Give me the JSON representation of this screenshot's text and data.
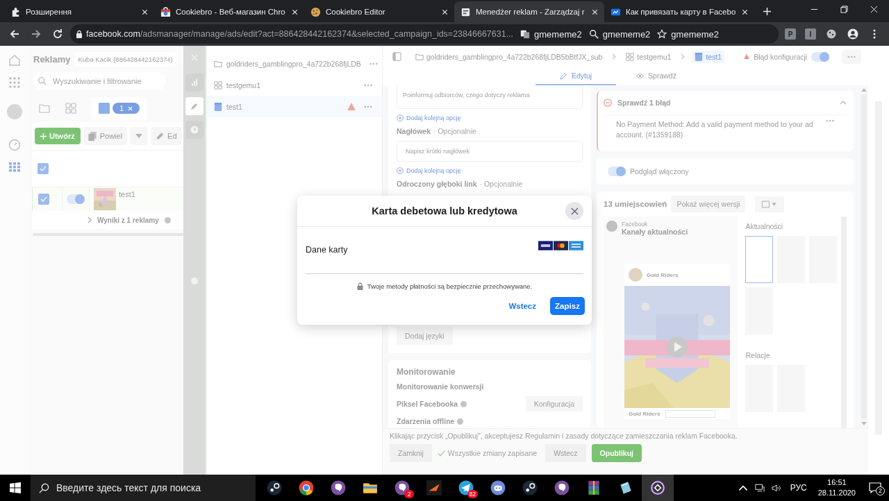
{
  "browser": {
    "tabs": [
      {
        "kind": "puzzle",
        "title": "Розширення",
        "selected": false
      },
      {
        "kind": "store",
        "title": "Cookiebro - Веб-магазин Chro",
        "selected": false
      },
      {
        "kind": "cookie",
        "title": "Cookiebro Editor",
        "selected": false
      },
      {
        "kind": "ads",
        "title": "Menedżer reklam - Zarządzaj r",
        "selected": true
      },
      {
        "kind": "fb",
        "title": "Как привязать карту в Facebo",
        "selected": false
      }
    ],
    "url_host": "facebook.com",
    "url_path": "/adsmanager/manage/ads/edit?act=886428442162374&selected_campaign_ids=23846667631...",
    "extensions": [
      {
        "kind": "translate",
        "label": "gmememe2"
      },
      {
        "kind": "search",
        "label": "gmememe2"
      },
      {
        "kind": "star",
        "label": "gmememe2"
      }
    ],
    "extension_letters": [
      "P",
      "I"
    ]
  },
  "left_panel": {
    "title": "Reklamy",
    "account": "Kuba Kacik (886428442162374)",
    "search_placeholder": "Wyszukiwanie i filtrowanie",
    "selection_count": "1",
    "create_button": "Utwórz",
    "duplicate_button": "Powiel",
    "edit_button": "Ed",
    "header_checked": true,
    "rows": [
      {
        "name": "test1",
        "checked": true,
        "on": true
      }
    ],
    "results": "Wyniki z 1 reklamy"
  },
  "tool_strip": [
    {
      "kind": "chart",
      "selected": false
    },
    {
      "kind": "pencil",
      "selected": true
    },
    {
      "kind": "clock",
      "selected": false
    }
  ],
  "tree": [
    {
      "kind": "campaign",
      "label": "goldriders_gamblingpro_4a722b268fjLDB",
      "selected": false,
      "warning": false
    },
    {
      "kind": "adset",
      "label": "testgemu1",
      "selected": false,
      "warning": false
    },
    {
      "kind": "ad",
      "label": "test1",
      "selected": true,
      "warning": true
    }
  ],
  "editor": {
    "breadcrumb": [
      {
        "kind": "campaign",
        "label": "goldriders_gamblingpro_4a722b268fjLDB5bBtfJX_sub",
        "selected": false
      },
      {
        "kind": "adset",
        "label": "testgemu1",
        "selected": false
      },
      {
        "kind": "ad",
        "label": "test1",
        "selected": true
      }
    ],
    "status": "Błąd konfiguracji",
    "status_on": true,
    "tabs": [
      {
        "kind": "edit",
        "label": "Edytuj",
        "selected": true
      },
      {
        "kind": "view",
        "label": "Sprawdź",
        "selected": false
      }
    ],
    "form": {
      "text_placeholder": "Poinformuj odbiorców, czego dotyczy reklama",
      "add_option": "Dodaj kolejną opcję",
      "headline_label": "Nagłówek",
      "optional": "· Opcjonalnie",
      "headline_placeholder": "Napisz krótki nagłówek",
      "add_option_2": "Dodaj kolejną opcję",
      "deeplink_label": "Odroczony głęboki link",
      "deeplink_optional": "· Opcjonalnie",
      "add_languages": "Dodaj języki"
    },
    "monitoring": {
      "title": "Monitorowanie",
      "subtitle": "Monitorowanie konwersji",
      "pixel": "Piksel Facebooka",
      "configure": "Konfiguracja",
      "offline": "Zdarzenia offline"
    },
    "errors": {
      "title": "Sprawdź 1 błąd",
      "message": "No Payment Method: Add a valid payment method to your ad account. (#1359188)"
    },
    "preview": {
      "toggle_label": "Podgląd włączony",
      "on": true,
      "placements": "13 umiejscowień",
      "more_versions": "Pokaż więcej wersji",
      "platform": "Facebook",
      "placement": "Kanały aktualności",
      "page_name": "Gold Riders",
      "footer_name": "Gold Riders",
      "feed_label": "Aktualności",
      "stories_label": "Relacje"
    },
    "footer": {
      "notice": "Klikając przycisk „Opublikuj”, akceptujesz Regulamin i zasady dotyczące zamieszczania reklam Facebooka.",
      "close": "Zamknij",
      "saved": "Wszystkie zmiany zapisane",
      "back": "Wstecz",
      "publish": "Opublikuj"
    }
  },
  "dialog": {
    "title": "Karta debetowa lub kredytowa",
    "field_label": "Dane karty",
    "secure_note": "Twoje metody płatności są bezpiecznie przechowywane.",
    "back": "Wstecz",
    "save": "Zapisz"
  },
  "taskbar": {
    "search_placeholder": "Введите здесь текст для поиска",
    "apps": [
      {
        "kind": "steam",
        "selected": false
      },
      {
        "kind": "chrome",
        "selected": false
      },
      {
        "kind": "viber",
        "selected": false
      },
      {
        "kind": "folder",
        "selected": false
      },
      {
        "kind": "viber",
        "selected": false,
        "badge": "2"
      },
      {
        "kind": "arrow",
        "selected": false
      },
      {
        "kind": "telegram",
        "selected": false,
        "badge": "82"
      },
      {
        "kind": "discord",
        "selected": false
      },
      {
        "kind": "steam",
        "selected": false
      },
      {
        "kind": "viber",
        "selected": false
      },
      {
        "kind": "winrar",
        "selected": false
      },
      {
        "kind": "notes",
        "selected": false
      },
      {
        "kind": "ring",
        "selected": true
      }
    ],
    "language": "РУС",
    "time": "16:51",
    "date": "28.11.2020",
    "notifications": "2"
  }
}
